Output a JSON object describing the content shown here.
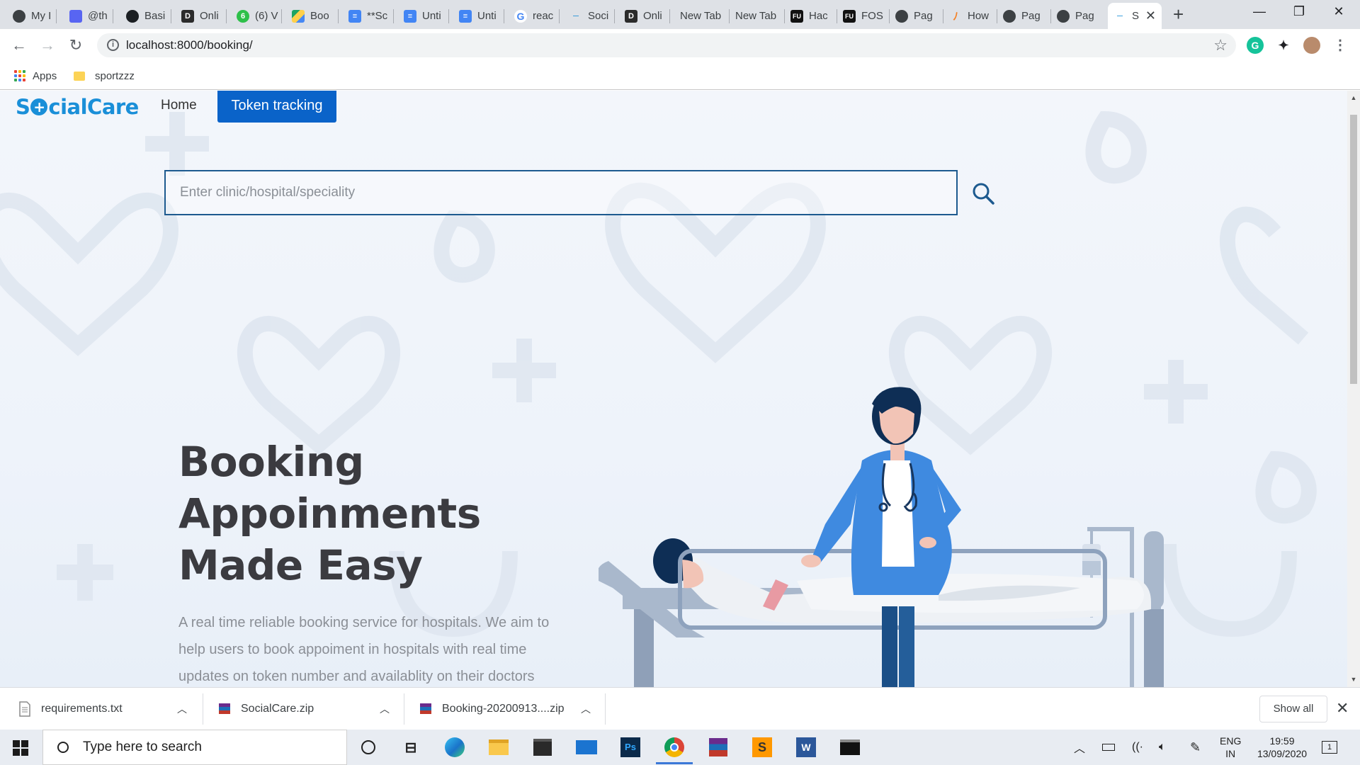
{
  "browser": {
    "tabs": [
      {
        "label": "My I",
        "icon": "chrome-icon"
      },
      {
        "label": "@th",
        "icon": "discord-icon"
      },
      {
        "label": "Basi",
        "icon": "github-icon"
      },
      {
        "label": "Onli",
        "icon": "d-icon"
      },
      {
        "label": "(6) V",
        "icon": "green-icon"
      },
      {
        "label": "Boo",
        "icon": "drive-icon"
      },
      {
        "label": "**Sc",
        "icon": "docs-icon"
      },
      {
        "label": "Unti",
        "icon": "docs-icon"
      },
      {
        "label": "Unti",
        "icon": "docs-icon"
      },
      {
        "label": "reac",
        "icon": "google-icon"
      },
      {
        "label": "Soci",
        "icon": "socialcare-icon"
      },
      {
        "label": "Onli",
        "icon": "d-icon"
      },
      {
        "label": "New Tab",
        "icon": ""
      },
      {
        "label": "New Tab",
        "icon": ""
      },
      {
        "label": "Hac",
        "icon": "fu-icon"
      },
      {
        "label": "FOS",
        "icon": "fu-icon"
      },
      {
        "label": "Pag",
        "icon": "chrome-icon"
      },
      {
        "label": "How",
        "icon": "flame-icon"
      },
      {
        "label": "Pag",
        "icon": "chrome-icon"
      },
      {
        "label": "Pag",
        "icon": "chrome-icon"
      },
      {
        "label": "S",
        "icon": "socialcare-icon"
      }
    ],
    "url": "localhost:8000/booking/",
    "bookmarks": {
      "apps": "Apps",
      "folder": "sportzzz"
    }
  },
  "page": {
    "logo": {
      "before": "S",
      "after": "cialCare"
    },
    "nav": {
      "home": "Home",
      "token": "Token tracking"
    },
    "search": {
      "placeholder": "Enter clinic/hospital/speciality"
    },
    "hero": {
      "line1": "Booking",
      "line2": "Appoinments",
      "line3": "Made Easy",
      "description": "A real time reliable booking service for hospitals. We aim to help users to book appoiment in hospitals with real time updates on token number and availablity on their doctors"
    }
  },
  "downloads": {
    "items": [
      {
        "name": "requirements.txt"
      },
      {
        "name": "SocialCare.zip"
      },
      {
        "name": "Booking-20200913....zip"
      }
    ],
    "show_all": "Show all"
  },
  "taskbar": {
    "search_placeholder": "Type here to search",
    "lang": "ENG",
    "region": "IN",
    "time": "19:59",
    "date": "13/09/2020",
    "notifications": "1"
  },
  "colors": {
    "brand": "#1a8fd8",
    "token_button": "#0a63c9",
    "search_border": "#1d5a8f"
  }
}
